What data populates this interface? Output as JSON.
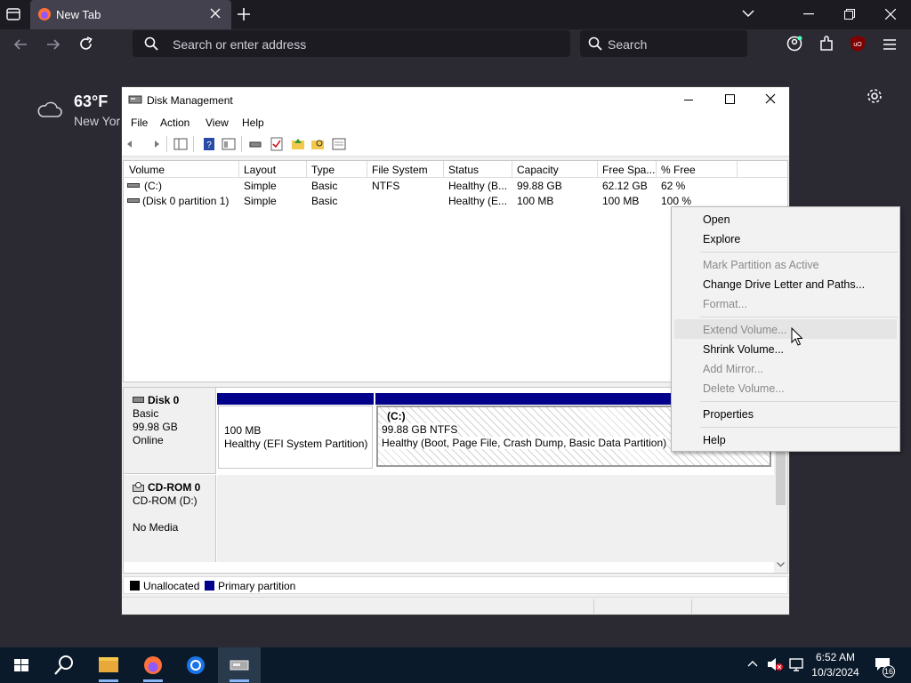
{
  "browser": {
    "tab_title": "New Tab",
    "url_placeholder": "Search or enter address",
    "search_placeholder": "Search"
  },
  "weather": {
    "temp": "63°F",
    "location": "New York"
  },
  "disk_mgmt": {
    "title": "Disk Management",
    "menu": [
      "File",
      "Action",
      "View",
      "Help"
    ],
    "columns": [
      "Volume",
      "Layout",
      "Type",
      "File System",
      "Status",
      "Capacity",
      "Free Spa...",
      "% Free"
    ],
    "rows": [
      [
        "(C:)",
        "Simple",
        "Basic",
        "NTFS",
        "Healthy (B...",
        "99.88 GB",
        "62.12 GB",
        "62 %"
      ],
      [
        "(Disk 0 partition 1)",
        "Simple",
        "Basic",
        "",
        "Healthy (E...",
        "100 MB",
        "100 MB",
        "100 %"
      ]
    ],
    "disk0": {
      "name": "Disk 0",
      "type": "Basic",
      "size": "99.98 GB",
      "state": "Online"
    },
    "part_efi": {
      "size": "100 MB",
      "status": "Healthy (EFI System Partition)"
    },
    "part_c": {
      "label": "(C:)",
      "size": "99.88 GB NTFS",
      "status": "Healthy (Boot, Page File, Crash Dump, Basic Data Partition)"
    },
    "cdrom": {
      "name": "CD-ROM 0",
      "drive": "CD-ROM (D:)",
      "media": "No Media"
    },
    "legend": {
      "unallocated": "Unallocated",
      "primary": "Primary partition"
    }
  },
  "context_menu": {
    "items": [
      {
        "label": "Open",
        "enabled": true
      },
      {
        "label": "Explore",
        "enabled": true
      },
      {
        "label": "Mark Partition as Active",
        "enabled": false
      },
      {
        "label": "Change Drive Letter and Paths...",
        "enabled": true
      },
      {
        "label": "Format...",
        "enabled": false
      },
      {
        "label": "Extend Volume...",
        "enabled": false
      },
      {
        "label": "Shrink Volume...",
        "enabled": true
      },
      {
        "label": "Add Mirror...",
        "enabled": false
      },
      {
        "label": "Delete Volume...",
        "enabled": false
      },
      {
        "label": "Properties",
        "enabled": true
      },
      {
        "label": "Help",
        "enabled": true
      }
    ]
  },
  "taskbar": {
    "time": "6:52 AM",
    "date": "10/3/2024",
    "notification_count": "16"
  },
  "colors": {
    "primary_partition": "#00008b",
    "unallocated": "#000000"
  }
}
